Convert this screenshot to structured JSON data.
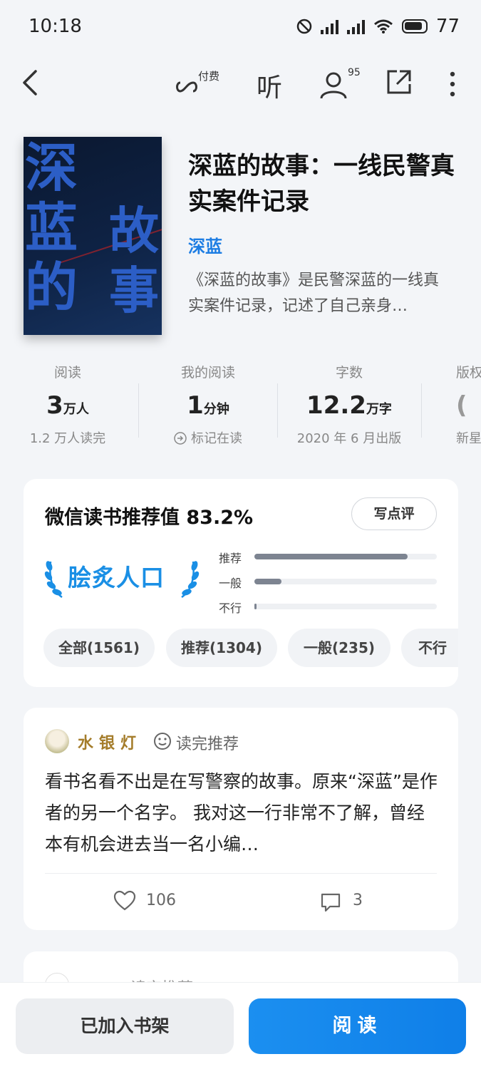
{
  "status_bar": {
    "time": "10:18",
    "battery": "77"
  },
  "nav": {
    "pay_label": "付费",
    "listen_label": "听",
    "readers_count": "95"
  },
  "book": {
    "cover_title_left": "深\n蓝\n的",
    "cover_title_right": "故\n事",
    "title": "深蓝的故事：一线民警真实案件记录",
    "author": "深蓝",
    "description": "《深蓝的故事》是民警深蓝的一线真实案件记录，记述了自己亲身…"
  },
  "stats": [
    {
      "label": "阅读",
      "value": "3",
      "unit": "万人",
      "sub": "1.2 万人读完"
    },
    {
      "label": "我的阅读",
      "value": "1",
      "unit": "分钟",
      "sub": "标记在读"
    },
    {
      "label": "字数",
      "value": "12.2",
      "unit": "万字",
      "sub": "2020 年 6 月出版"
    },
    {
      "label": "版权",
      "value": "",
      "unit": "",
      "sub": "新星"
    }
  ],
  "rating": {
    "heading": "微信读书推荐值 83.2%",
    "write_label": "写点评",
    "badge": "脍炙人口",
    "bars": [
      {
        "label": "推荐",
        "fraction": 0.84
      },
      {
        "label": "一般",
        "fraction": 0.15
      },
      {
        "label": "不行",
        "fraction": 0.01
      }
    ],
    "filters": [
      "全部(1561)",
      "推荐(1304)",
      "一般(235)",
      "不行"
    ]
  },
  "review": {
    "user": "水银灯",
    "tag": "读完推荐",
    "text": "看书名看不出是在写警察的故事。原来“深蓝”是作者的另一个名字。 我对这一行非常不了解，曾经本有机会进去当一名小编…",
    "likes": "106",
    "comments": "3"
  },
  "next_review": {
    "tag": "读完推荐"
  },
  "bottom": {
    "shelf_label": "已加入书架",
    "read_label": "阅读"
  },
  "colors": {
    "accent": "#1d7de3",
    "read_button": "#1b8ff0",
    "username": "#a47c2a"
  }
}
